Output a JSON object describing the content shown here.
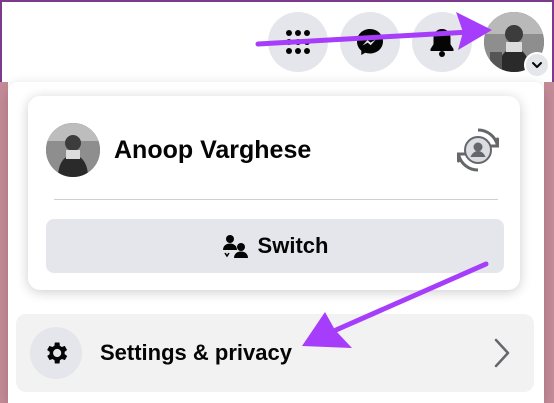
{
  "header": {
    "icons": [
      "menu-grid-icon",
      "messenger-icon",
      "notifications-bell-icon",
      "account-avatar"
    ],
    "account_chevron_icon": "chevron-down-icon"
  },
  "account_menu": {
    "profile": {
      "name": "Anoop Varghese",
      "switch_profile_icon": "switch-profile-icon"
    },
    "switch_button": {
      "label": "Switch",
      "icon": "switch-accounts-icon"
    },
    "items": [
      {
        "label": "Settings & privacy",
        "icon": "gear-icon",
        "trailing_icon": "chevron-right-icon"
      }
    ]
  },
  "annotations": {
    "arrow_color": "#a63dfa"
  },
  "colors": {
    "frame": "#7d3a8c",
    "button_bg": "#e4e6eb",
    "text": "#050505"
  }
}
